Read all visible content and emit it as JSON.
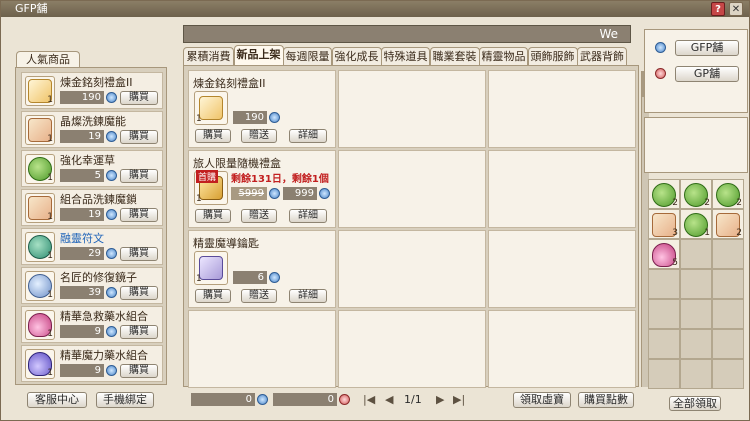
{
  "window": {
    "title": "GFP舖",
    "help_label": "?",
    "close_label": "✕"
  },
  "marquee": {
    "text": "We"
  },
  "left": {
    "tab_label": "人氣商品",
    "items": [
      {
        "name": "煉金銘刻禮盒II",
        "count": "1",
        "price": "190",
        "buy": "購買",
        "icon": "gift-box-icon",
        "blue": false
      },
      {
        "name": "晶燦洗鍊魔能",
        "count": "1",
        "price": "19",
        "buy": "購買",
        "icon": "scroll-icon",
        "blue": false
      },
      {
        "name": "強化幸運草",
        "count": "1",
        "price": "5",
        "buy": "購買",
        "icon": "clover-icon",
        "blue": false
      },
      {
        "name": "組合品洗鍊魔鎖",
        "count": "1",
        "price": "19",
        "buy": "購買",
        "icon": "scroll-icon",
        "blue": false
      },
      {
        "name": "融靈符文",
        "count": "1",
        "price": "29",
        "buy": "購買",
        "icon": "rune-stone-icon",
        "blue": true
      },
      {
        "name": "名匠的修復鏡子",
        "count": "1",
        "price": "39",
        "buy": "購買",
        "icon": "mirror-icon",
        "blue": false
      },
      {
        "name": "精華急救藥水組合",
        "count": "1",
        "price": "9",
        "buy": "購買",
        "icon": "potion-icon",
        "blue": false
      },
      {
        "name": "精華魔力藥水組合",
        "count": "1",
        "price": "9",
        "buy": "購買",
        "icon": "mana-potion-icon",
        "blue": false
      }
    ],
    "customer_service": "客服中心",
    "phone_bind": "手機綁定"
  },
  "tabs": [
    "累積消費",
    "新品上架",
    "每週限量",
    "強化成長",
    "特殊道具",
    "職業套裝",
    "精靈物品",
    "頭飾服飾",
    "武器背飾"
  ],
  "active_tab": 1,
  "cells": [
    {
      "name": "煉金銘刻禮盒II",
      "count": "1",
      "price": "190",
      "buy": "購買",
      "gift": "贈送",
      "detail": "詳細",
      "icon": "gift-box-icon",
      "orig_price": "",
      "limit": "",
      "badge": ""
    },
    {
      "name": "旅人限量隨機禮盒",
      "count": "1",
      "price": "999",
      "orig_price": "5999",
      "limit": "剩餘131日，剩餘1個",
      "badge": "首購",
      "buy": "購買",
      "gift": "贈送",
      "detail": "詳細",
      "icon": "treasure-box-icon"
    },
    {
      "name": "精靈魔導鑰匙",
      "count": "1",
      "price": "6",
      "buy": "購買",
      "gift": "贈送",
      "detail": "詳細",
      "icon": "key-icon",
      "orig_price": "",
      "limit": "",
      "badge": ""
    }
  ],
  "bottom": {
    "gfp_balance": "0",
    "gp_balance": "0",
    "page": "1/1",
    "prev_label": "◀",
    "next_label": "▶",
    "first_label": "|◀",
    "last_label": "▶|",
    "claim_label": "領取虛寶",
    "buy_points_label": "購買點數"
  },
  "right": {
    "gfp_shop": "GFP舖",
    "gp_shop": "GP舖",
    "claim_all": "全部領取",
    "slots": [
      {
        "icon": "clover-icon",
        "count": "2"
      },
      {
        "icon": "clover-icon",
        "count": "2"
      },
      {
        "icon": "clover-icon",
        "count": "2"
      },
      {
        "icon": "scroll-icon",
        "count": "3"
      },
      {
        "icon": "clover-icon",
        "count": "1"
      },
      {
        "icon": "scroll-icon",
        "count": "2"
      },
      {
        "icon": "potion-icon",
        "count": "5"
      }
    ]
  },
  "colors": {
    "accent_blue": "#1f64b9",
    "price_bg": "#8b8071",
    "limit_red": "#c21f1f"
  }
}
